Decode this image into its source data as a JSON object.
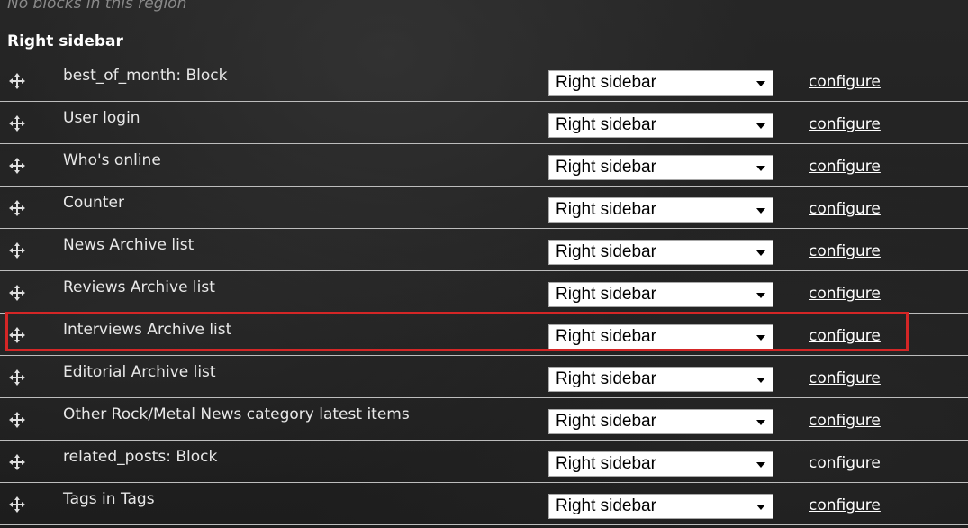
{
  "empty_note": "No blocks in this region",
  "region_title": "Right sidebar",
  "rows": [
    {
      "title": "best_of_month: Block",
      "region": "Right sidebar",
      "link": "configure"
    },
    {
      "title": "User login",
      "region": "Right sidebar",
      "link": "configure"
    },
    {
      "title": "Who's online",
      "region": "Right sidebar",
      "link": "configure"
    },
    {
      "title": "Counter",
      "region": "Right sidebar",
      "link": "configure"
    },
    {
      "title": "News Archive list",
      "region": "Right sidebar",
      "link": "configure"
    },
    {
      "title": "Reviews Archive list",
      "region": "Right sidebar",
      "link": "configure"
    },
    {
      "title": "Interviews Archive list",
      "region": "Right sidebar",
      "link": "configure"
    },
    {
      "title": "Editorial Archive list",
      "region": "Right sidebar",
      "link": "configure"
    },
    {
      "title": "Other Rock/Metal News category latest items",
      "region": "Right sidebar",
      "link": "configure"
    },
    {
      "title": "related_posts: Block",
      "region": "Right sidebar",
      "link": "configure"
    },
    {
      "title": "Tags in Tags",
      "region": "Right sidebar",
      "link": "configure"
    }
  ],
  "icons": {
    "drag_handle": "drag-handle-icon",
    "dropdown_arrow": "chevron-down-icon"
  },
  "colors": {
    "highlight": "#d42626",
    "background": "#1f1f1f"
  }
}
